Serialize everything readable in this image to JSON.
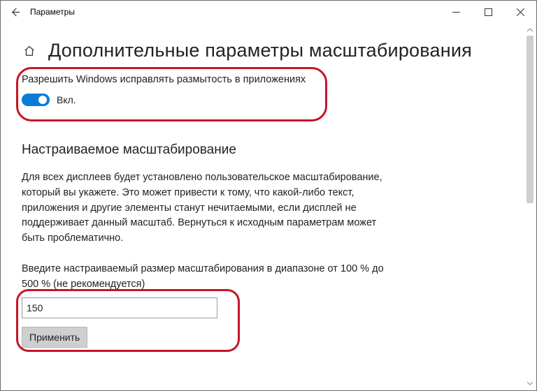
{
  "window": {
    "app_title": "Параметры"
  },
  "page": {
    "title": "Дополнительные параметры масштабирования"
  },
  "fix_blurry": {
    "heading": "Разрешить Windows исправлять размытость в приложениях",
    "toggle_state_label": "Вкл.",
    "toggle_on": true
  },
  "custom_scaling": {
    "heading": "Настраиваемое масштабирование",
    "description": "Для всех дисплеев будет установлено пользовательское масштабирование, который вы укажете. Это может привести к тому, что какой-либо текст, приложения и другие элементы станут нечитаемыми, если дисплей не поддерживает данный масштаб. Вернуться к исходным параметрам может быть проблематично.",
    "input_label": "Введите настраиваемый размер масштабирования в диапазоне от 100 % до 500 % (не рекомендуется)",
    "input_value": "150",
    "apply_label": "Применить"
  },
  "highlight_color": "#c41627"
}
